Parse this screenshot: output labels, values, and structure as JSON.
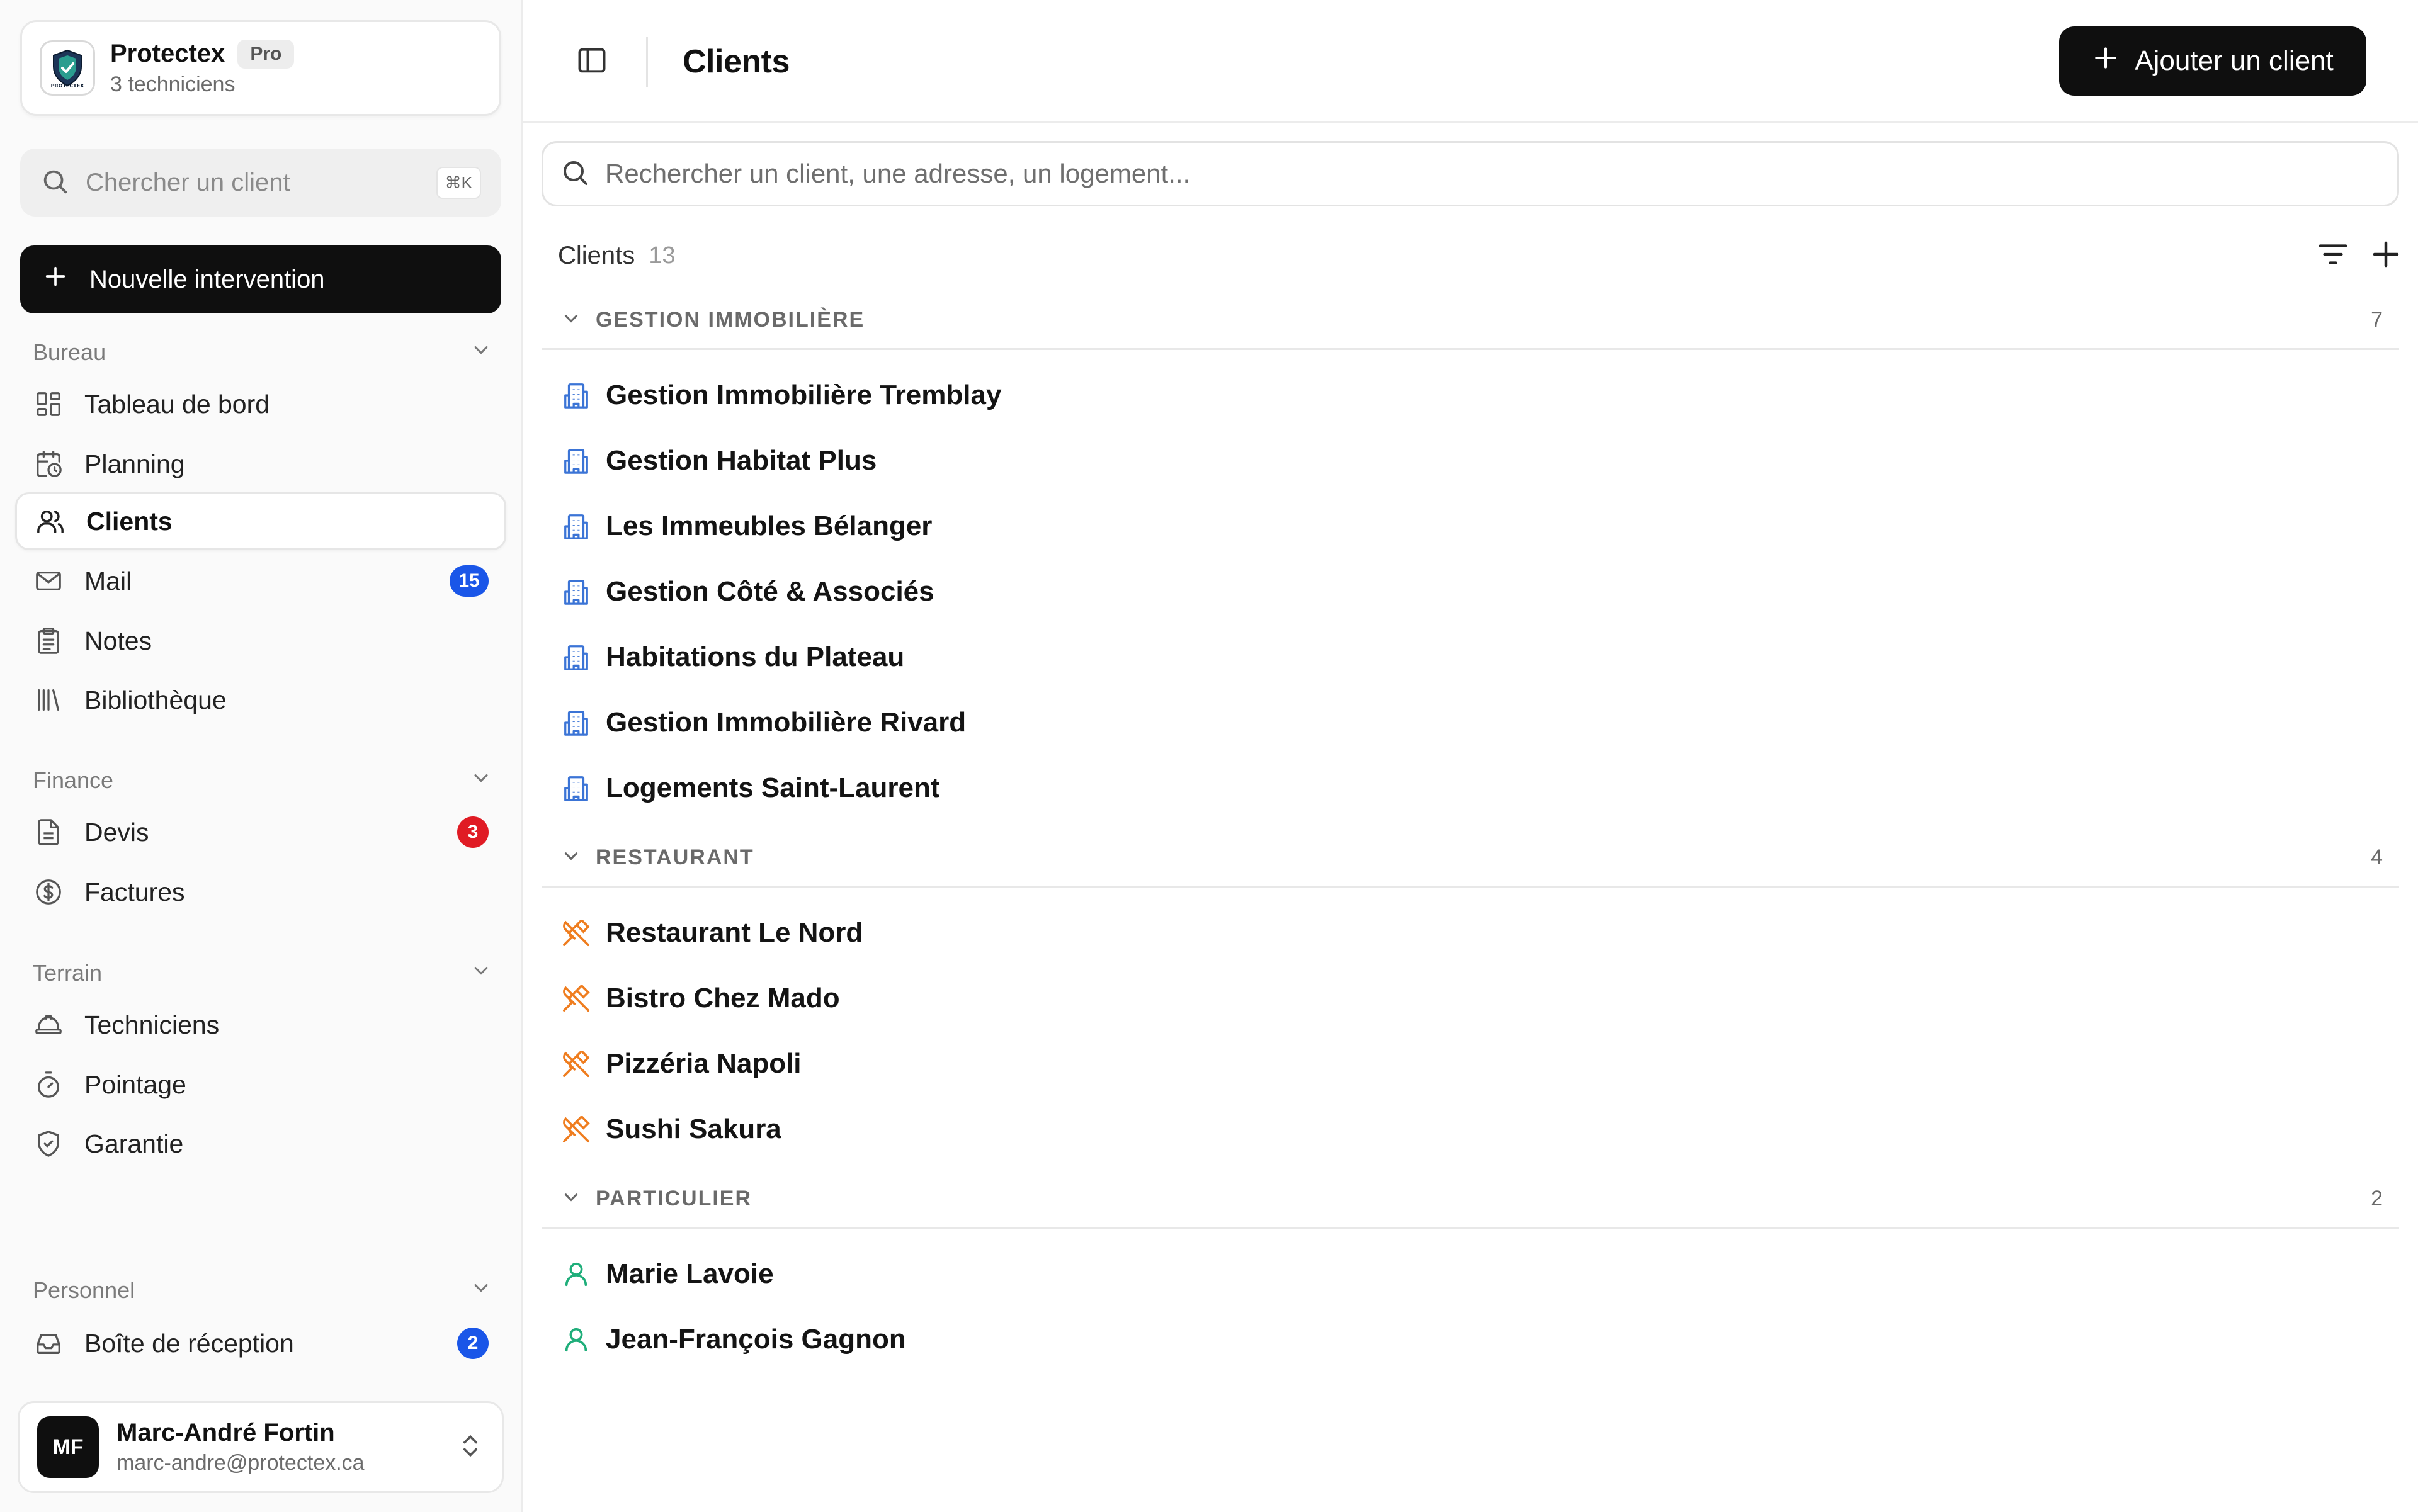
{
  "org": {
    "name": "Protectex",
    "plan": "Pro",
    "subtitle": "3 techniciens",
    "logo_text": "PROTECTEX"
  },
  "sidebar": {
    "search_placeholder": "Chercher un client",
    "search_shortcut": "⌘K",
    "new_button": "Nouvelle intervention",
    "sections": {
      "bureau": "Bureau",
      "finance": "Finance",
      "terrain": "Terrain",
      "personnel": "Personnel"
    },
    "items": {
      "dashboard": "Tableau de bord",
      "planning": "Planning",
      "clients": "Clients",
      "mail": "Mail",
      "notes": "Notes",
      "library": "Bibliothèque",
      "quotes": "Devis",
      "invoices": "Factures",
      "technicians": "Techniciens",
      "timesheet": "Pointage",
      "warranty": "Garantie",
      "inbox": "Boîte de réception"
    },
    "badges": {
      "mail": "15",
      "quotes": "3",
      "inbox": "2"
    }
  },
  "user": {
    "initials": "MF",
    "name": "Marc-André Fortin",
    "email": "marc-andre@protectex.ca"
  },
  "header": {
    "title": "Clients",
    "add_button": "Ajouter un client"
  },
  "main": {
    "search_placeholder": "Rechercher un client, une adresse, un logement...",
    "list_title": "Clients",
    "list_count": "13",
    "groups": [
      {
        "name": "GESTION IMMOBILIÈRE",
        "count": "7",
        "clients": [
          "Gestion Immobilière Tremblay",
          "Gestion Habitat Plus",
          "Les Immeubles Bélanger",
          "Gestion Côté & Associés",
          "Habitations du Plateau",
          "Gestion Immobilière Rivard",
          "Logements Saint-Laurent"
        ]
      },
      {
        "name": "RESTAURANT",
        "count": "4",
        "clients": [
          "Restaurant Le Nord",
          "Bistro Chez Mado",
          "Pizzéria Napoli",
          "Sushi Sakura"
        ]
      },
      {
        "name": "PARTICULIER",
        "count": "2",
        "clients": [
          "Marie Lavoie",
          "Jean-François Gagnon"
        ]
      }
    ]
  },
  "colors": {
    "primary": "#0f0f0f",
    "badge_blue": "#1a56e8",
    "badge_red": "#e01b24",
    "building_icon": "#3b74d6",
    "restaurant_icon": "#ef7d1f",
    "person_icon": "#1fae7a"
  }
}
